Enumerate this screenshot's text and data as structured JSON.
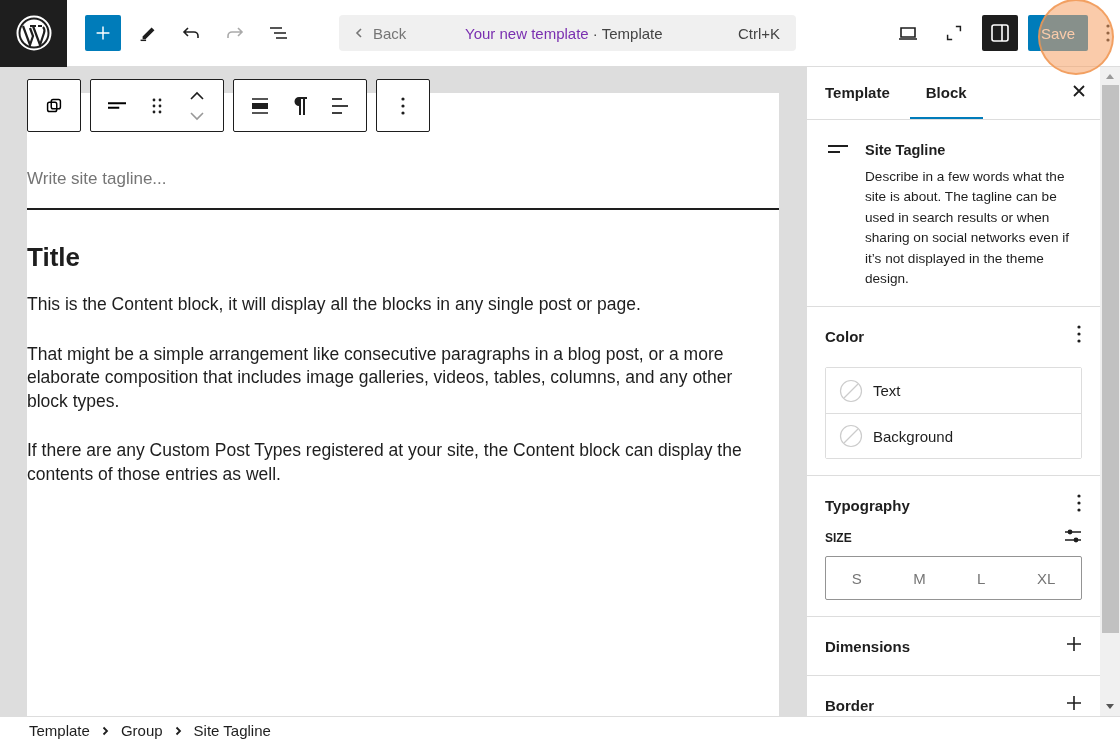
{
  "toolbar": {
    "tools": [
      {
        "kind": "inserter",
        "disabled": false
      },
      {
        "kind": "tools",
        "disabled": false
      },
      {
        "kind": "undo",
        "disabled": false
      },
      {
        "kind": "redo",
        "disabled": true
      },
      {
        "kind": "list-view",
        "disabled": false
      }
    ],
    "command_bar": {
      "back": "Back",
      "title": "Your new template",
      "separator": " · ",
      "type": "Template",
      "shortcut": "Ctrl+K"
    },
    "actions": [
      {
        "kind": "view",
        "pressed": false
      },
      {
        "kind": "fullscreen",
        "pressed": false
      },
      {
        "kind": "sidebar",
        "pressed": true
      }
    ],
    "save": "Save"
  },
  "canvas": {
    "tagline_placeholder": "Write site tagline...",
    "title": "Title",
    "paragraphs": [
      "This is the Content block, it will display all the blocks in any single post or page.",
      "That might be a simple arrangement like consecutive paragraphs in a blog post, or a more elaborate composition that includes image galleries, videos, tables, columns, and any other block types.",
      "If there are any Custom Post Types registered at your site, the Content block can display the contents of those entries as well."
    ]
  },
  "sidebar": {
    "tabs": [
      {
        "label": "Template",
        "selected": false
      },
      {
        "label": "Block",
        "selected": true
      }
    ],
    "block": {
      "name": "Site Tagline",
      "description": "Describe in a few words what the site is about. The tagline can be used in search results or when sharing on social networks even if it’s not displayed in the theme design."
    },
    "panels": [
      {
        "kind": "color",
        "title": "Color",
        "items": [
          "Text",
          "Background"
        ]
      },
      {
        "kind": "typography",
        "title": "Typography",
        "size_label": "SIZE",
        "sizes": [
          {
            "label": "S",
            "selected": false
          },
          {
            "label": "M",
            "selected": false
          },
          {
            "label": "L",
            "selected": false
          },
          {
            "label": "XL",
            "selected": false
          }
        ]
      },
      {
        "kind": "collapsed",
        "title": "Dimensions"
      },
      {
        "kind": "collapsed",
        "title": "Border"
      }
    ]
  },
  "breadcrumb": [
    "Template",
    "Group",
    "Site Tagline"
  ]
}
